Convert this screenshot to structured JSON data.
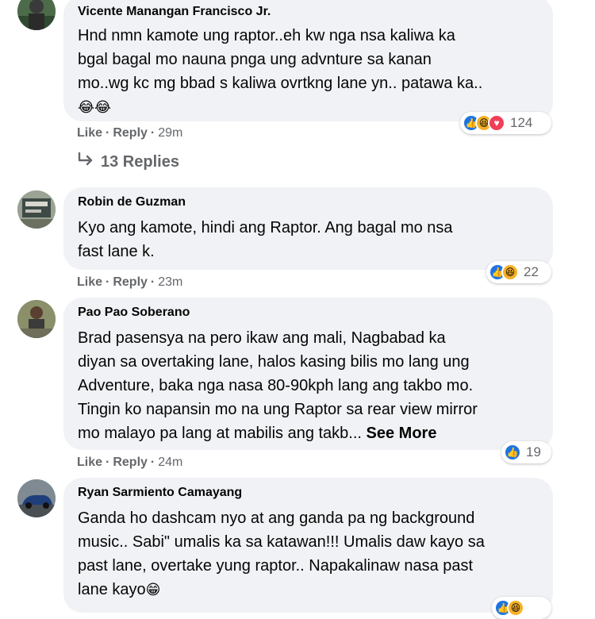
{
  "comments": [
    {
      "author": "Vicente Manangan Francisco Jr.",
      "text": "Hnd nmn kamote ung raptor..eh kw nga nsa kaliwa ka\nbgal bagal mo nauna pnga ung advnture sa kanan\nmo..wg kc mg bbad s kaliwa ovrtkng lane yn.. patawa ka..",
      "emoji": "😂😂",
      "like_label": "Like",
      "reply_label": "Reply",
      "time": "29m",
      "reaction_icons": [
        "like-icon",
        "haha-icon",
        "love-icon"
      ],
      "reaction_count": "124",
      "replies_label": "13 Replies"
    },
    {
      "author": "Robin de Guzman",
      "text": "Kyo ang kamote, hindi ang Raptor. Ang bagal mo nsa\nfast lane k.",
      "like_label": "Like",
      "reply_label": "Reply",
      "time": "23m",
      "reaction_icons": [
        "like-icon",
        "haha-icon"
      ],
      "reaction_count": "22"
    },
    {
      "author": "Pao Pao Soberano",
      "text": "Brad pasensya na pero ikaw ang mali, Nagbabad ka\ndiyan sa overtaking lane, halos kasing bilis mo lang ung\nAdventure, baka nga nasa 80-90kph lang ang takbo mo.\nTingin ko napansin mo na ung Raptor sa rear view mirror\nmo malayo pa lang at mabilis ang takb... ",
      "see_more": "See More",
      "like_label": "Like",
      "reply_label": "Reply",
      "time": "24m",
      "reaction_icons": [
        "like-icon"
      ],
      "reaction_count": "19"
    },
    {
      "author": "Ryan Sarmiento Camayang",
      "text": "Ganda ho dashcam nyo at ang ganda pa ng background\nmusic.. Sabi\" umalis ka sa katawan!!! Umalis daw kayo sa\npast lane, overtake yung raptor.. Napakalinaw nasa past\nlane kayo",
      "emoji": "😁"
    }
  ],
  "colors": {
    "bubble": "#f0f2f5",
    "secondary_text": "#65676b",
    "like_blue": "#1b74e4",
    "haha_yellow": "#f7b125",
    "love_red": "#f33e58"
  }
}
